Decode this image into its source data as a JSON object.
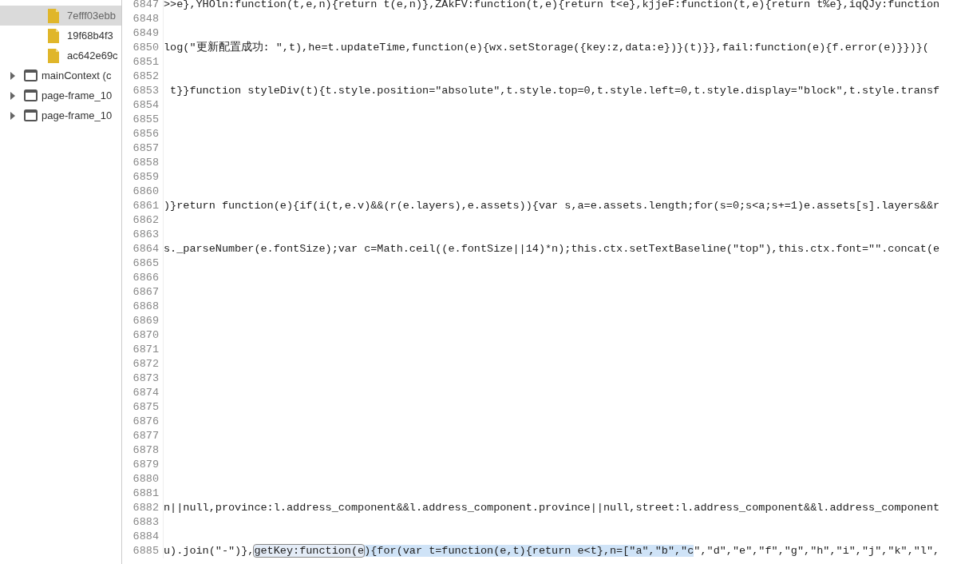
{
  "sidebar": {
    "items": [
      {
        "kind": "file",
        "label": "7efff03ebb",
        "selected": true
      },
      {
        "kind": "file",
        "label": "19f68b4f3",
        "selected": false
      },
      {
        "kind": "file",
        "label": "ac642e69c",
        "selected": false
      },
      {
        "kind": "frame",
        "label": "mainContext (c",
        "selected": false,
        "expanded": false
      },
      {
        "kind": "frame",
        "label": "page-frame_10",
        "selected": false,
        "expanded": false
      },
      {
        "kind": "frame",
        "label": "page-frame_10",
        "selected": false,
        "expanded": false
      }
    ]
  },
  "editor": {
    "lines": [
      {
        "number": "6847",
        "segments": [
          {
            "kind": "plain",
            "text": ">>e},YHOln:function(t,e,n){return t(e,n)},ZAkFV:function(t,e){return t<e},kjjeF:function(t,e){return t%e},iqQJy:function"
          }
        ]
      },
      {
        "number": "6848"
      },
      {
        "number": "6849"
      },
      {
        "number": "6850",
        "segments": [
          {
            "kind": "plain",
            "text": "log(\"更新配置成功: \",t),he=t.updateTime,function(e){wx.setStorage({key:z,data:e})}(t)}},fail:function(e){f.error(e)}})}("
          }
        ]
      },
      {
        "number": "6851"
      },
      {
        "number": "6852"
      },
      {
        "number": "6853",
        "segments": [
          {
            "kind": "plain",
            "text": " t}}function styleDiv(t){t.style.position=\"absolute\",t.style.top=0,t.style.left=0,t.style.display=\"block\",t.style.transf"
          }
        ]
      },
      {
        "number": "6854"
      },
      {
        "number": "6855"
      },
      {
        "number": "6856"
      },
      {
        "number": "6857"
      },
      {
        "number": "6858"
      },
      {
        "number": "6859"
      },
      {
        "number": "6860"
      },
      {
        "number": "6861",
        "segments": [
          {
            "kind": "plain",
            "text": ")}return function(e){if(i(t,e.v)&&(r(e.layers),e.assets)){var s,a=e.assets.length;for(s=0;s<a;s+=1)e.assets[s].layers&&r"
          }
        ]
      },
      {
        "number": "6862"
      },
      {
        "number": "6863"
      },
      {
        "number": "6864",
        "segments": [
          {
            "kind": "plain",
            "text": "s._parseNumber(e.fontSize);var c=Math.ceil((e.fontSize||14)*n);this.ctx.setTextBaseline(\"top\"),this.ctx.font=\"\".concat(e"
          }
        ]
      },
      {
        "number": "6865"
      },
      {
        "number": "6866"
      },
      {
        "number": "6867"
      },
      {
        "number": "6868"
      },
      {
        "number": "6869"
      },
      {
        "number": "6870"
      },
      {
        "number": "6871"
      },
      {
        "number": "6872"
      },
      {
        "number": "6873"
      },
      {
        "number": "6874"
      },
      {
        "number": "6875"
      },
      {
        "number": "6876"
      },
      {
        "number": "6877"
      },
      {
        "number": "6878"
      },
      {
        "number": "6879"
      },
      {
        "number": "6880"
      },
      {
        "number": "6881"
      },
      {
        "number": "6882",
        "segments": [
          {
            "kind": "plain",
            "text": "n||null,province:l.address_component&&l.address_component.province||null,street:l.address_component&&l.address_component"
          }
        ]
      },
      {
        "number": "6883"
      },
      {
        "number": "6884"
      },
      {
        "number": "6885",
        "segments": [
          {
            "kind": "plain",
            "text": "u).join(\"-\")},"
          },
          {
            "kind": "match",
            "text": "getKey:function(e"
          },
          {
            "kind": "selected",
            "text": "){for(var t=function(e,t){return e<t},n=[\"a\",\"b\",\"c"
          },
          {
            "kind": "plain",
            "text": "\",\"d\",\"e\",\"f\",\"g\",\"h\",\"i\",\"j\",\"k\",\"l\","
          }
        ]
      }
    ]
  }
}
